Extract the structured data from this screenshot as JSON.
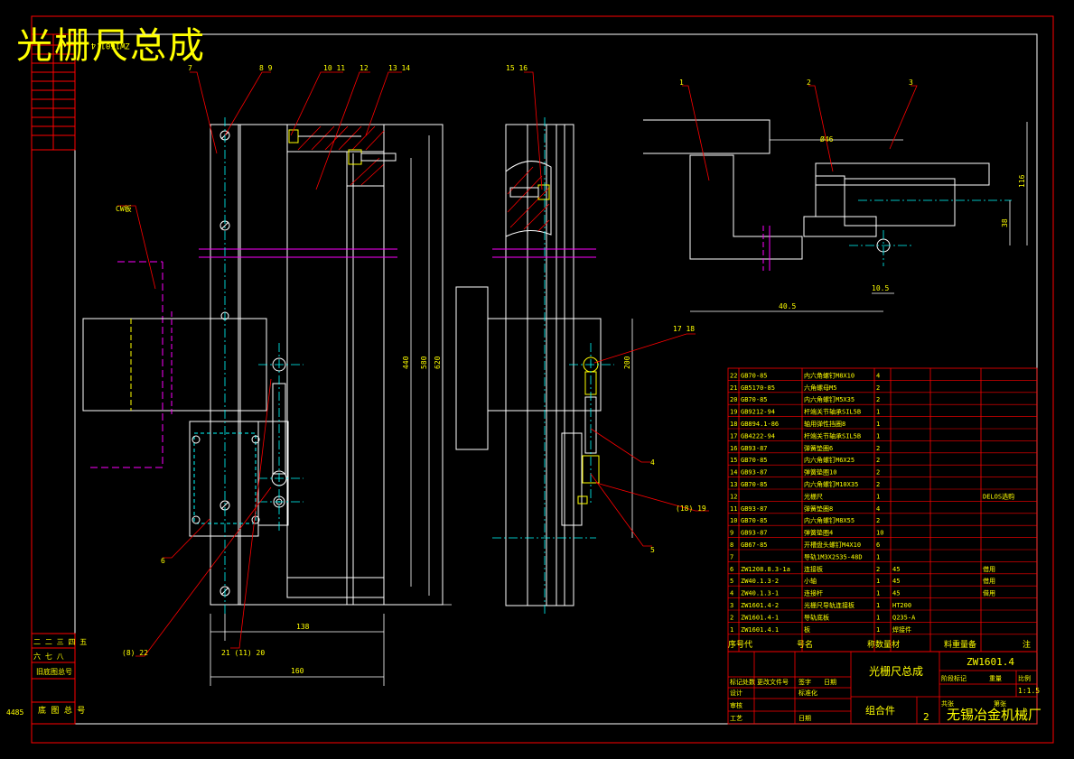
{
  "title": "光栅尺总成",
  "drawing_code_top": "ZW1601.4",
  "count_label": "4485",
  "part_labels": {
    "p7": "7",
    "p89": "8 9",
    "p1011": "10 11",
    "p12": "12",
    "p1314": "13 14",
    "p1516": "15 16",
    "p1": "1",
    "p2": "2",
    "p3": "3",
    "p1718": "17 18",
    "p4": "4",
    "p5": "5",
    "p18_19": "(18)  19",
    "p6": "6",
    "p_822": "(8)  22",
    "p_21_20": "21 (11) 20",
    "cw": "CW板"
  },
  "dims": {
    "d440": "440",
    "d580": "580",
    "d620": "620",
    "d200": "200",
    "d138": "138",
    "d160": "160",
    "d116": "116",
    "d38": "38",
    "d10_5": "10.5",
    "d40_5": "40.5",
    "d46": "Ø46"
  },
  "bom_rows": [
    {
      "no": "22",
      "code": "GB70-85",
      "name": "内六角螺钉M8X10",
      "qty": "4",
      "mat": "",
      "note": ""
    },
    {
      "no": "21",
      "code": "GB5170-85",
      "name": "六角螺母M5",
      "qty": "2",
      "mat": "",
      "note": ""
    },
    {
      "no": "20",
      "code": "GB70-85",
      "name": "内六角螺钉M5X35",
      "qty": "2",
      "mat": "",
      "note": ""
    },
    {
      "no": "19",
      "code": "GB9212-94",
      "name": "杆端关节轴承SIL5B",
      "qty": "1",
      "mat": "",
      "note": ""
    },
    {
      "no": "18",
      "code": "GB894.1-86",
      "name": "轴用弹性挡圈8",
      "qty": "1",
      "mat": "",
      "note": ""
    },
    {
      "no": "17",
      "code": "GB4222-94",
      "name": "杆端关节轴承SIL5B",
      "qty": "1",
      "mat": "",
      "note": ""
    },
    {
      "no": "16",
      "code": "GB93-87",
      "name": "弹簧垫圈6",
      "qty": "2",
      "mat": "",
      "note": ""
    },
    {
      "no": "15",
      "code": "GB70-85",
      "name": "内六角螺钉M6X25",
      "qty": "2",
      "mat": "",
      "note": ""
    },
    {
      "no": "14",
      "code": "GB93-87",
      "name": "弹簧垫圈10",
      "qty": "2",
      "mat": "",
      "note": ""
    },
    {
      "no": "13",
      "code": "GB70-85",
      "name": "内六角螺钉M10X35",
      "qty": "2",
      "mat": "",
      "note": ""
    },
    {
      "no": "12",
      "code": "",
      "name": "光栅尺",
      "qty": "1",
      "mat": "",
      "note": "DELOS选购"
    },
    {
      "no": "11",
      "code": "GB93-87",
      "name": "弹簧垫圈8",
      "qty": "4",
      "mat": "",
      "note": ""
    },
    {
      "no": "10",
      "code": "GB70-85",
      "name": "内六角螺钉M8X55",
      "qty": "2",
      "mat": "",
      "note": ""
    },
    {
      "no": "9",
      "code": "GB93-87",
      "name": "弹簧垫圈4",
      "qty": "10",
      "mat": "",
      "note": ""
    },
    {
      "no": "8",
      "code": "GB67-85",
      "name": "开槽盘头螺钉M4X10",
      "qty": "6",
      "mat": "",
      "note": ""
    },
    {
      "no": "7",
      "code": "",
      "name": "导轨1M3X2535-48D",
      "qty": "1",
      "mat": "",
      "note": ""
    },
    {
      "no": "6",
      "code": "ZW1208.8.3-1a",
      "name": "连接板",
      "qty": "2",
      "mat": "45",
      "note": "借用"
    },
    {
      "no": "5",
      "code": "ZW40.1.3-2",
      "name": "小轴",
      "qty": "1",
      "mat": "45",
      "note": "借用"
    },
    {
      "no": "4",
      "code": "ZW40.1.3-1",
      "name": "连接杆",
      "qty": "1",
      "mat": "45",
      "note": "借用"
    },
    {
      "no": "3",
      "code": "ZW1601.4-2",
      "name": "光栅尺导轨连接板",
      "qty": "1",
      "mat": "HT200",
      "note": ""
    },
    {
      "no": "2",
      "code": "ZW1601.4-1",
      "name": "导轨底板",
      "qty": "1",
      "mat": "Q235-A",
      "note": ""
    },
    {
      "no": "1",
      "code": "ZW1601.4.1",
      "name": "板",
      "qty": "1",
      "mat": "焊接件",
      "note": ""
    }
  ],
  "bom_header": [
    "序号代",
    "号名",
    "称数量材",
    "料重量备",
    "注"
  ],
  "title_block": {
    "name": "光栅尺总成",
    "code": "ZW1601.4",
    "scale": "1:1.5",
    "assembly": "组合件",
    "sheets": "2",
    "company": "无锡冶金机械厂",
    "labels": [
      "标记处数",
      "更改文件号",
      "签字",
      "日期",
      "设计",
      "标准化",
      "审核",
      "工艺",
      "日期",
      "阶段标记",
      "重量",
      "比例",
      "共张",
      "第张"
    ]
  },
  "left_stamp": {
    "r1": "二 二 三 四 五",
    "r2": "六 七 八",
    "r3": "旧底图总号",
    "r4": "底 图 总 号"
  }
}
